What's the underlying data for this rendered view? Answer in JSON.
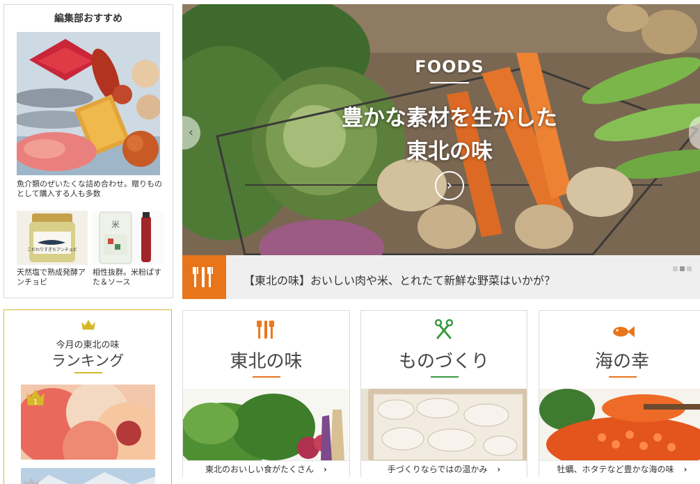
{
  "recommend": {
    "title": "編集部おすすめ",
    "main_caption": "魚介類のぜいたくな詰め合わせ。贈りものとして購入する人も多数",
    "sub_items": [
      {
        "caption": "天然塩で熟成発酵アンチョビ",
        "jar_label": "こだわりすぎたアンチョビ"
      },
      {
        "caption": "相性抜群。米粉ぱすた＆ソース",
        "pack_label": "米"
      }
    ]
  },
  "hero": {
    "category": "FOODS",
    "headline_line1": "豊かな素材を生かした",
    "headline_line2": "東北の味",
    "caption": "【東北の味】おいしい肉や米、とれたて新鮮な野菜はいかが？",
    "slides_total": 3,
    "slide_current": 2,
    "accent_color": "#e8751a"
  },
  "ranking": {
    "subtitle": "今月の東北の味",
    "title": "ランキング",
    "first_rank": "1",
    "accent_color": "#d7b72a"
  },
  "categories": [
    {
      "title": "東北の味",
      "footer": "東北のおいしい食がたくさん",
      "chevron": "›",
      "icon": "fork-knife-icon",
      "color": "#e8751a"
    },
    {
      "title": "ものづくり",
      "footer": "手づくりならではの温かみ",
      "chevron": "›",
      "icon": "scissors-icon",
      "color": "#3a9a3f"
    },
    {
      "title": "海の幸",
      "footer": "牡蠣、ホタテなど豊かな海の味",
      "chevron": "›",
      "icon": "fish-icon",
      "color": "#e8751a"
    }
  ]
}
